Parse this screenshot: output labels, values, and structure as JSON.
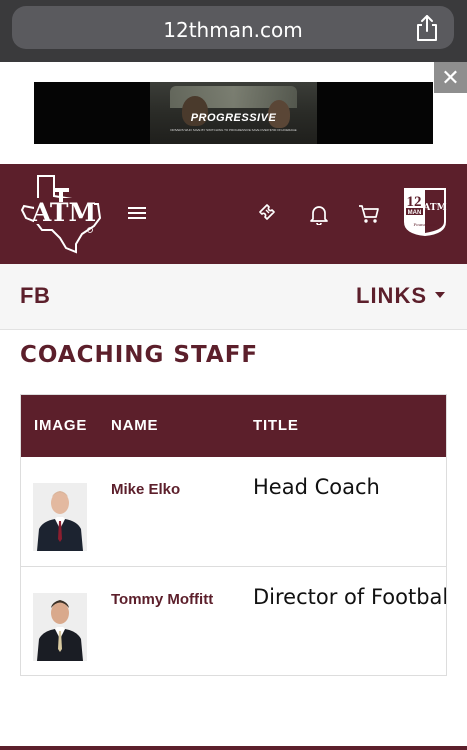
{
  "browser": {
    "url": "12thman.com",
    "share_icon": "share-icon"
  },
  "ad": {
    "brand": "PROGRESSIVE",
    "fine_print": "DRIVERS WHO SAVE BY SWITCHING TO PROGRESSIVE SAVE OVER $700 ON AVERAGE",
    "close_label": "✕"
  },
  "header": {
    "logo_icon": "texas-am-logo-icon",
    "menu_icon": "hamburger-menu-icon",
    "ticket_icon": "ticket-icon",
    "bell_icon": "bell-icon",
    "cart_icon": "cart-icon",
    "foundation_logo_icon": "12th-man-foundation-logo-icon",
    "colors": {
      "maroon": "#5c1f2b",
      "white": "#ffffff"
    }
  },
  "subnav": {
    "sport": "FB",
    "links_label": "LINKS"
  },
  "section": {
    "title": "COACHING STAFF"
  },
  "table": {
    "columns": [
      "IMAGE",
      "NAME",
      "TITLE"
    ],
    "rows": [
      {
        "name": "Mike Elko",
        "title": "Head Coach",
        "tie_color": "#8b1e2f"
      },
      {
        "name": "Tommy Moffitt",
        "title": "Director of Football",
        "tie_color": "#d8c9a0"
      }
    ]
  }
}
